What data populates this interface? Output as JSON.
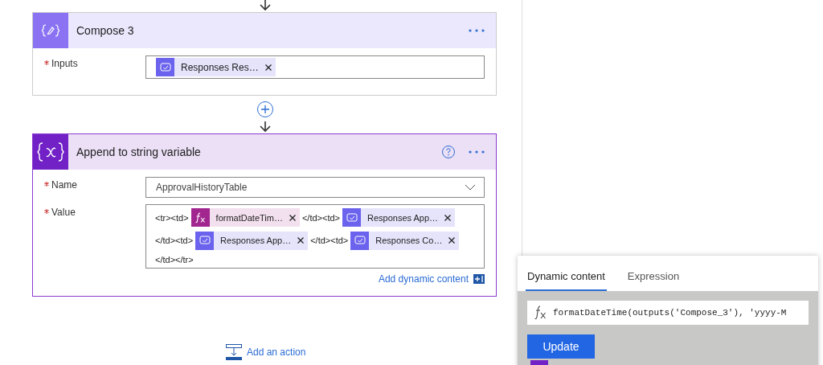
{
  "compose": {
    "title": "Compose 3",
    "fields": [
      {
        "label": "Inputs",
        "required": true,
        "tokens": [
          {
            "kind": "dynamic",
            "text": "Responses Res…"
          }
        ]
      }
    ]
  },
  "append": {
    "title": "Append to string variable",
    "name_field": {
      "label": "Name",
      "required": true,
      "value": "ApprovalHistoryTable"
    },
    "value_field": {
      "label": "Value",
      "required": true,
      "segments": [
        {
          "kind": "text",
          "text": "<tr><td>"
        },
        {
          "kind": "expression",
          "text": "formatDateTim…"
        },
        {
          "kind": "text",
          "text": "</td><td>"
        },
        {
          "kind": "dynamic",
          "text": "Responses App…"
        },
        {
          "kind": "text",
          "text": "</td><td>"
        },
        {
          "kind": "dynamic",
          "text": "Responses App…"
        },
        {
          "kind": "text",
          "text": "</td><td>"
        },
        {
          "kind": "dynamic",
          "text": "Responses Co…"
        },
        {
          "kind": "text",
          "text": "</td></tr>"
        }
      ]
    },
    "link": "Add dynamic content"
  },
  "add_action": "Add an action",
  "panel": {
    "tabs": [
      {
        "label": "Dynamic content",
        "selected": true
      },
      {
        "label": "Expression",
        "selected": false
      }
    ],
    "expression": "formatDateTime(outputs('Compose_3'), 'yyyy-M",
    "button": "Update"
  }
}
